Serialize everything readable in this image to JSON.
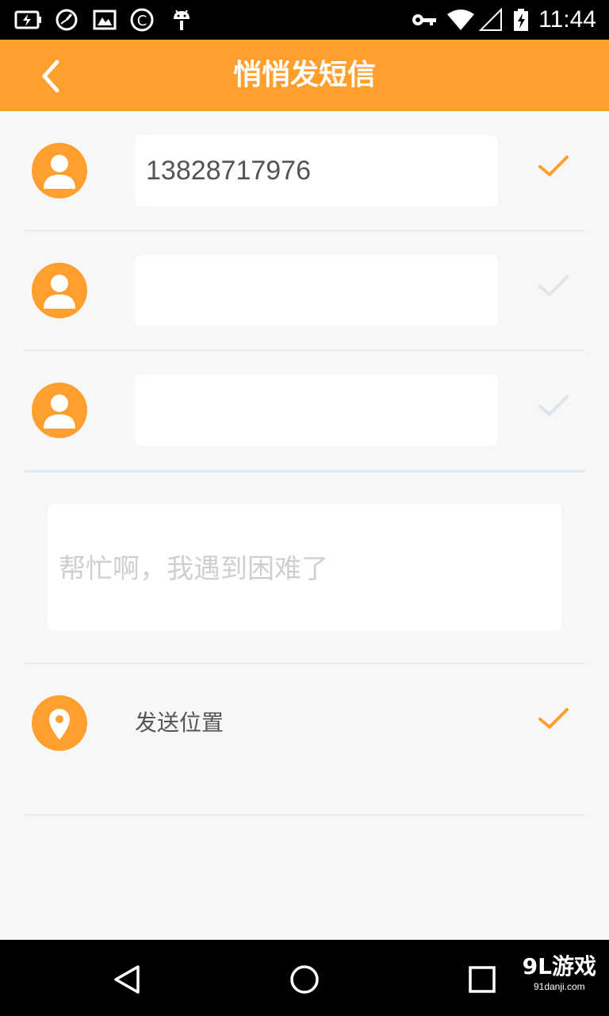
{
  "status_bar": {
    "time": "11:44",
    "icons": [
      "battery-charging-icon",
      "speedometer-icon",
      "gallery-icon",
      "copyright-icon",
      "android-icon",
      "vpn-key-icon",
      "wifi-icon",
      "signal-icon",
      "battery-icon"
    ]
  },
  "app_bar": {
    "title": "悄悄发短信",
    "back_icon": "chevron-left-icon",
    "color": "#ff9f2e"
  },
  "contacts": [
    {
      "value": "13828717976",
      "placeholder": "",
      "checked": true
    },
    {
      "value": "",
      "placeholder": "",
      "checked": false
    },
    {
      "value": "",
      "placeholder": "",
      "checked": false
    }
  ],
  "message": {
    "placeholder": "帮忙啊，我遇到困难了",
    "value": ""
  },
  "location": {
    "label": "发送位置",
    "icon": "map-pin-icon",
    "checked": true
  },
  "colors": {
    "accent": "#ff9f2e",
    "check_active": "#ff9f2e",
    "check_inactive": "#dde4ea"
  },
  "nav_bar": {
    "buttons": [
      "back-triangle-icon",
      "home-circle-icon",
      "recents-square-icon"
    ]
  },
  "watermark": {
    "logo": "9L游戏",
    "url": "91danji.com"
  }
}
